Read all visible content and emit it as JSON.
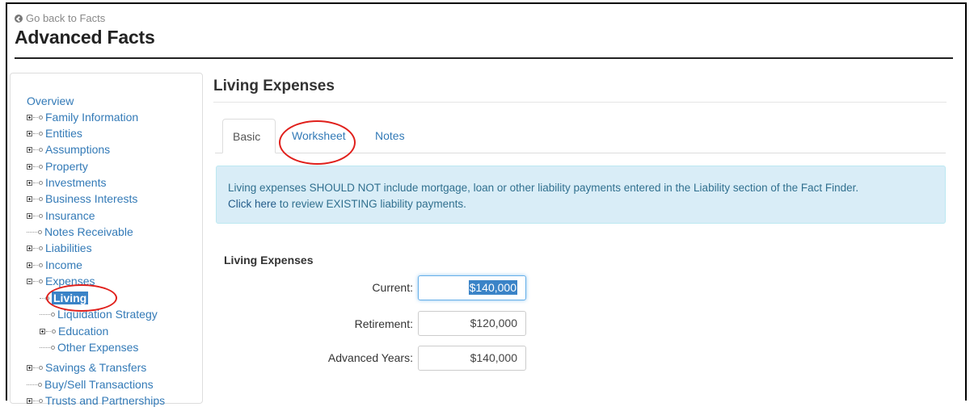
{
  "header": {
    "back_link": "Go back to Facts",
    "title": "Advanced Facts"
  },
  "sidebar": {
    "items": [
      {
        "label": "Overview"
      },
      {
        "label": "Family Information"
      },
      {
        "label": "Entities"
      },
      {
        "label": "Assumptions"
      },
      {
        "label": "Property"
      },
      {
        "label": "Investments"
      },
      {
        "label": "Business Interests"
      },
      {
        "label": "Insurance"
      },
      {
        "label": "Notes Receivable"
      },
      {
        "label": "Liabilities"
      },
      {
        "label": "Income"
      },
      {
        "label": "Expenses"
      },
      {
        "label": "Living"
      },
      {
        "label": "Liquidation Strategy"
      },
      {
        "label": "Education"
      },
      {
        "label": "Other Expenses"
      },
      {
        "label": "Savings & Transfers"
      },
      {
        "label": "Buy/Sell Transactions"
      },
      {
        "label": "Trusts and Partnerships"
      }
    ],
    "selected": "Living"
  },
  "main": {
    "heading": "Living Expenses",
    "tabs": [
      {
        "label": "Basic",
        "active": true
      },
      {
        "label": "Worksheet",
        "active": false
      },
      {
        "label": "Notes",
        "active": false
      }
    ],
    "alert": {
      "text": "Living expenses SHOULD NOT include mortgage, loan or other liability payments entered in the Liability section of the Fact Finder.",
      "link": "Click here",
      "link_suffix": " to review EXISTING liability payments."
    },
    "section_label": "Living Expenses",
    "fields": [
      {
        "label": "Current:",
        "value": "$140,000"
      },
      {
        "label": "Retirement:",
        "value": "$120,000"
      },
      {
        "label": "Advanced Years:",
        "value": "$140,000"
      }
    ]
  },
  "colors": {
    "link": "#337ab7",
    "selected_bg": "#3a83c7",
    "alert_bg": "#d9edf7",
    "annotation": "#e0201c"
  }
}
